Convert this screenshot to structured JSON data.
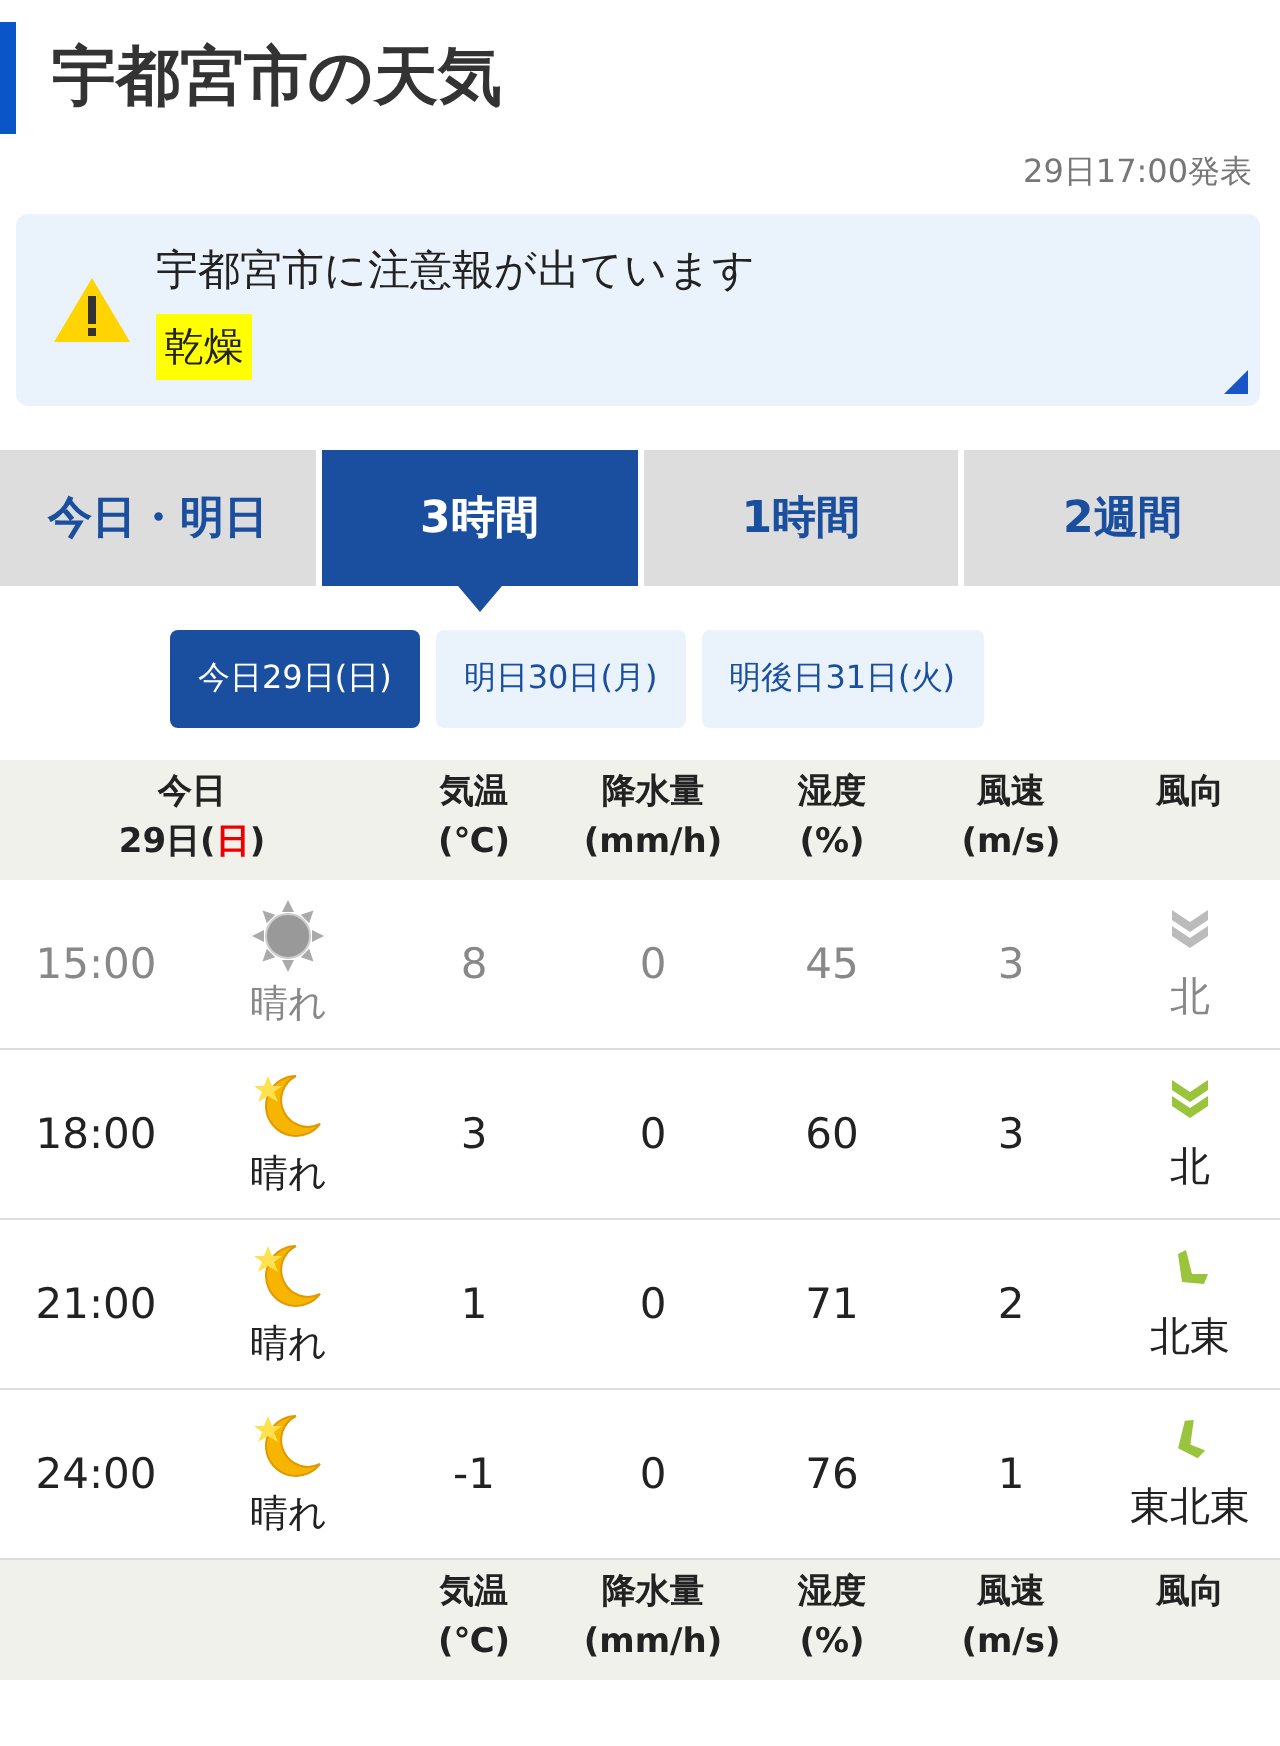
{
  "title": "宇都宮市の天気",
  "issued": "29日17:00発表",
  "alert": {
    "message": "宇都宮市に注意報が出ています",
    "warnings": [
      "乾燥"
    ]
  },
  "tabs": [
    {
      "label": "今日・明日",
      "selected": false
    },
    {
      "label": "3時間",
      "selected": true
    },
    {
      "label": "1時間",
      "selected": false
    },
    {
      "label": "2週間",
      "selected": false
    }
  ],
  "dates": [
    {
      "label": "今日29日(日)",
      "selected": true
    },
    {
      "label": "明日30日(月)",
      "selected": false
    },
    {
      "label": "明後日31日(火)",
      "selected": false
    }
  ],
  "table": {
    "day": {
      "label": "今日",
      "date": "29日(",
      "weekday": "日",
      "close": ")"
    },
    "columns": [
      {
        "name": "気温",
        "unit": "(℃)"
      },
      {
        "name": "降水量",
        "unit": "(mm/h)"
      },
      {
        "name": "湿度",
        "unit": "(%)"
      },
      {
        "name": "風速",
        "unit": "(m/s)"
      },
      {
        "name": "風向"
      }
    ],
    "rows": [
      {
        "time": "15:00",
        "past": true,
        "weather": {
          "kind": "sunny",
          "label": "晴れ"
        },
        "temp": "8",
        "precip": "0",
        "humidity": "45",
        "wind_speed": "3",
        "wind_direction": {
          "kind": "south",
          "label": "北"
        }
      },
      {
        "time": "18:00",
        "past": false,
        "weather": {
          "kind": "clear_night",
          "label": "晴れ"
        },
        "temp": "3",
        "precip": "0",
        "humidity": "60",
        "wind_speed": "3",
        "wind_direction": {
          "kind": "south",
          "label": "北"
        }
      },
      {
        "time": "21:00",
        "past": false,
        "weather": {
          "kind": "clear_night",
          "label": "晴れ"
        },
        "temp": "1",
        "precip": "0",
        "humidity": "71",
        "wind_speed": "2",
        "wind_direction": {
          "kind": "southwest",
          "label": "北東"
        }
      },
      {
        "time": "24:00",
        "past": false,
        "weather": {
          "kind": "clear_night",
          "label": "晴れ"
        },
        "temp": "-1",
        "precip": "0",
        "humidity": "76",
        "wind_speed": "1",
        "wind_direction": {
          "kind": "west_southwest",
          "label": "東北東"
        }
      }
    ],
    "footer_columns": [
      {
        "name": "気温",
        "unit": "(℃)"
      },
      {
        "name": "降水量",
        "unit": "(mm/h)"
      },
      {
        "name": "湿度",
        "unit": "(%)"
      },
      {
        "name": "風速",
        "unit": "(m/s)"
      },
      {
        "name": "風向"
      }
    ]
  }
}
